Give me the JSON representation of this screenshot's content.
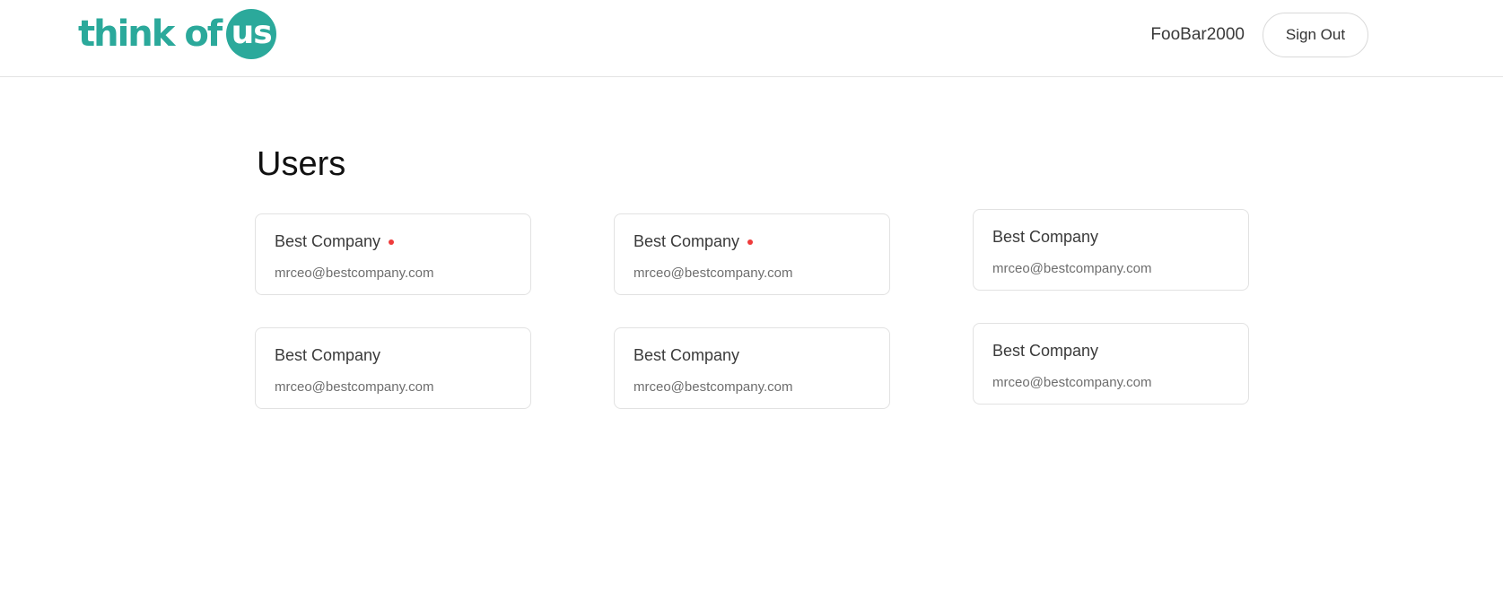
{
  "header": {
    "logo_text": "think of",
    "logo_badge": "us",
    "username": "FooBar2000",
    "signout_label": "Sign Out",
    "brand_color": "#2ba99b"
  },
  "main": {
    "title": "Users",
    "notification_color": "#ef3b3b",
    "users": [
      {
        "name": "Best Company",
        "email": "mrceo@bestcompany.com",
        "unread": true
      },
      {
        "name": "Best Company",
        "email": "mrceo@bestcompany.com",
        "unread": true
      },
      {
        "name": "Best Company",
        "email": "mrceo@bestcompany.com",
        "unread": false
      },
      {
        "name": "Best Company",
        "email": "mrceo@bestcompany.com",
        "unread": false
      },
      {
        "name": "Best Company",
        "email": "mrceo@bestcompany.com",
        "unread": false
      },
      {
        "name": "Best Company",
        "email": "mrceo@bestcompany.com",
        "unread": false
      }
    ]
  }
}
